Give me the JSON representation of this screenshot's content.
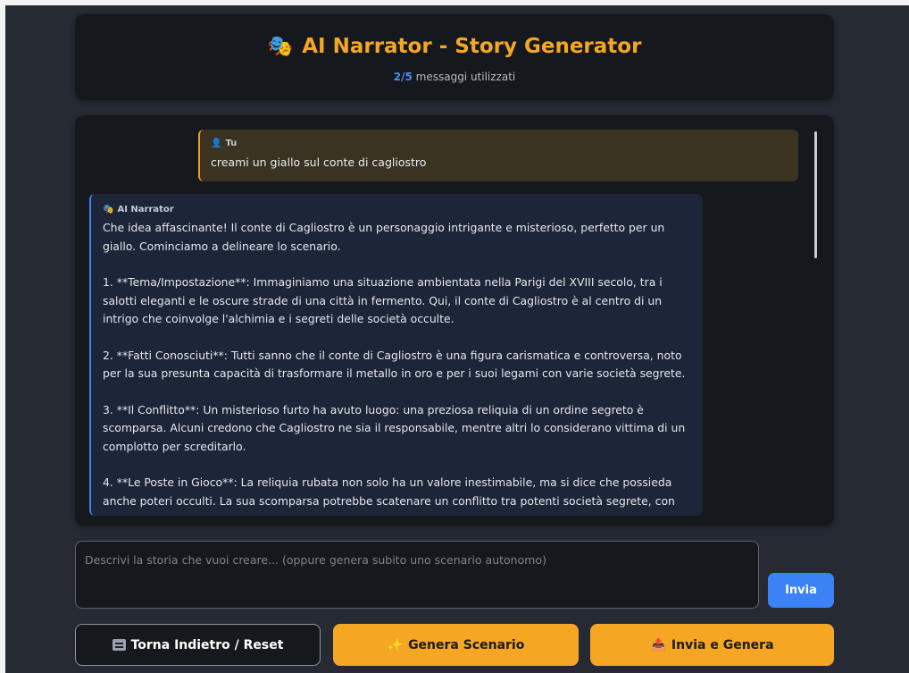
{
  "header": {
    "title_icon": "theater-masks-icon",
    "title_emoji": "🎭",
    "title": "AI Narrator - Story Generator",
    "usage_count": "2/5",
    "usage_label": "messaggi utilizzati"
  },
  "chat": {
    "user_message": {
      "sender_emoji": "👤",
      "sender": "Tu",
      "text": "creami un giallo sul conte di cagliostro"
    },
    "ai_message": {
      "sender_emoji": "🎭",
      "sender": "AI Narrator",
      "paragraphs": [
        "Che idea affascinante! Il conte di Cagliostro è un personaggio intrigante e misterioso, perfetto per un giallo. Cominciamo a delineare lo scenario.",
        "1. **Tema/Impostazione**: Immaginiamo una situazione ambientata nella Parigi del XVIII secolo, tra i salotti eleganti e le oscure strade di una città in fermento. Qui, il conte di Cagliostro è al centro di un intrigo che coinvolge l'alchimia e i segreti delle società occulte.",
        "2. **Fatti Conosciuti**: Tutti sanno che il conte di Cagliostro è una figura carismatica e controversa, noto per la sua presunta capacità di trasformare il metallo in oro e per i suoi legami con varie società segrete.",
        "3. **Il Conflitto**: Un misterioso furto ha avuto luogo: una preziosa reliquia di un ordine segreto è scomparsa. Alcuni credono che Cagliostro ne sia il responsabile, mentre altri lo considerano vittima di un complotto per screditarlo.",
        "4. **Le Poste in Gioco**: La reliquia rubata non solo ha un valore inestimabile, ma si dice che possieda anche poteri occulti. La sua scomparsa potrebbe scatenare un conflitto tra potenti società segrete, con conseguenze"
      ]
    }
  },
  "input": {
    "placeholder": "Descrivi la storia che vuoi creare... (oppure genera subito uno scenario autonomo)",
    "value": ""
  },
  "buttons": {
    "send": "Invia",
    "reset_emoji": "🔙",
    "reset": "Torna Indietro / Reset",
    "generate_emoji": "✨",
    "generate": "Genera Scenario",
    "send_generate_emoji": "📤",
    "send_generate": "Invia e Genera"
  },
  "colors": {
    "accent": "#f5a623",
    "primary": "#3b82f6",
    "background": "#252a33",
    "panel": "#15181d"
  }
}
